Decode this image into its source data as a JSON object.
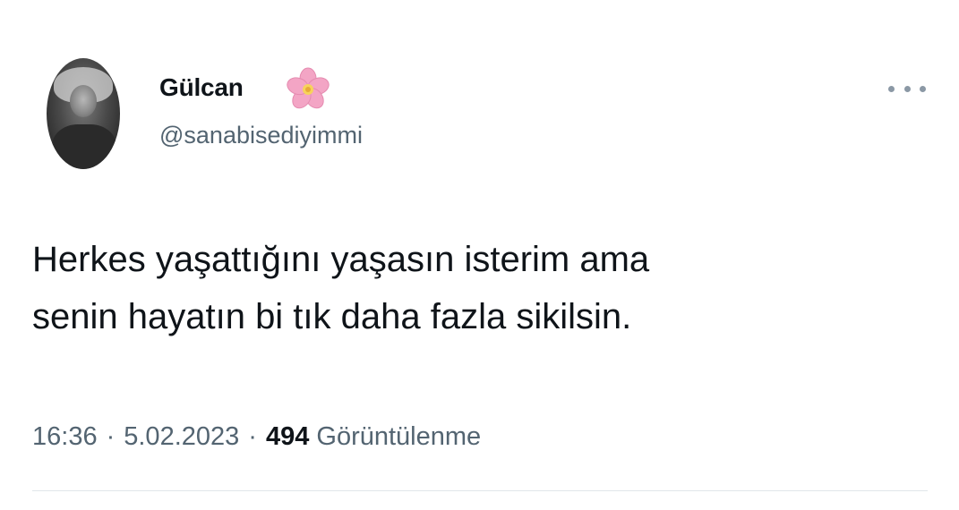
{
  "tweet": {
    "author": {
      "display_name": "Gülcan",
      "emoji_icon": "cherry-blossom-icon",
      "handle": "@sanabisediyimmi"
    },
    "text_lines": [
      "Herkes yaşattığını yaşasın isterim ama",
      "senin hayatın bi tık daha fazla sikilsin."
    ],
    "meta": {
      "time": "16:36",
      "separator": "·",
      "date": "5.02.2023",
      "views_count": "494",
      "views_label": "Görüntülenme"
    },
    "more_icon": "more-horizontal-icon"
  },
  "colors": {
    "text_primary": "#0f1419",
    "text_secondary": "#536471",
    "flower_pink": "#f3a5c5",
    "flower_center": "#f7d35a",
    "divider": "#e1e6ea"
  }
}
